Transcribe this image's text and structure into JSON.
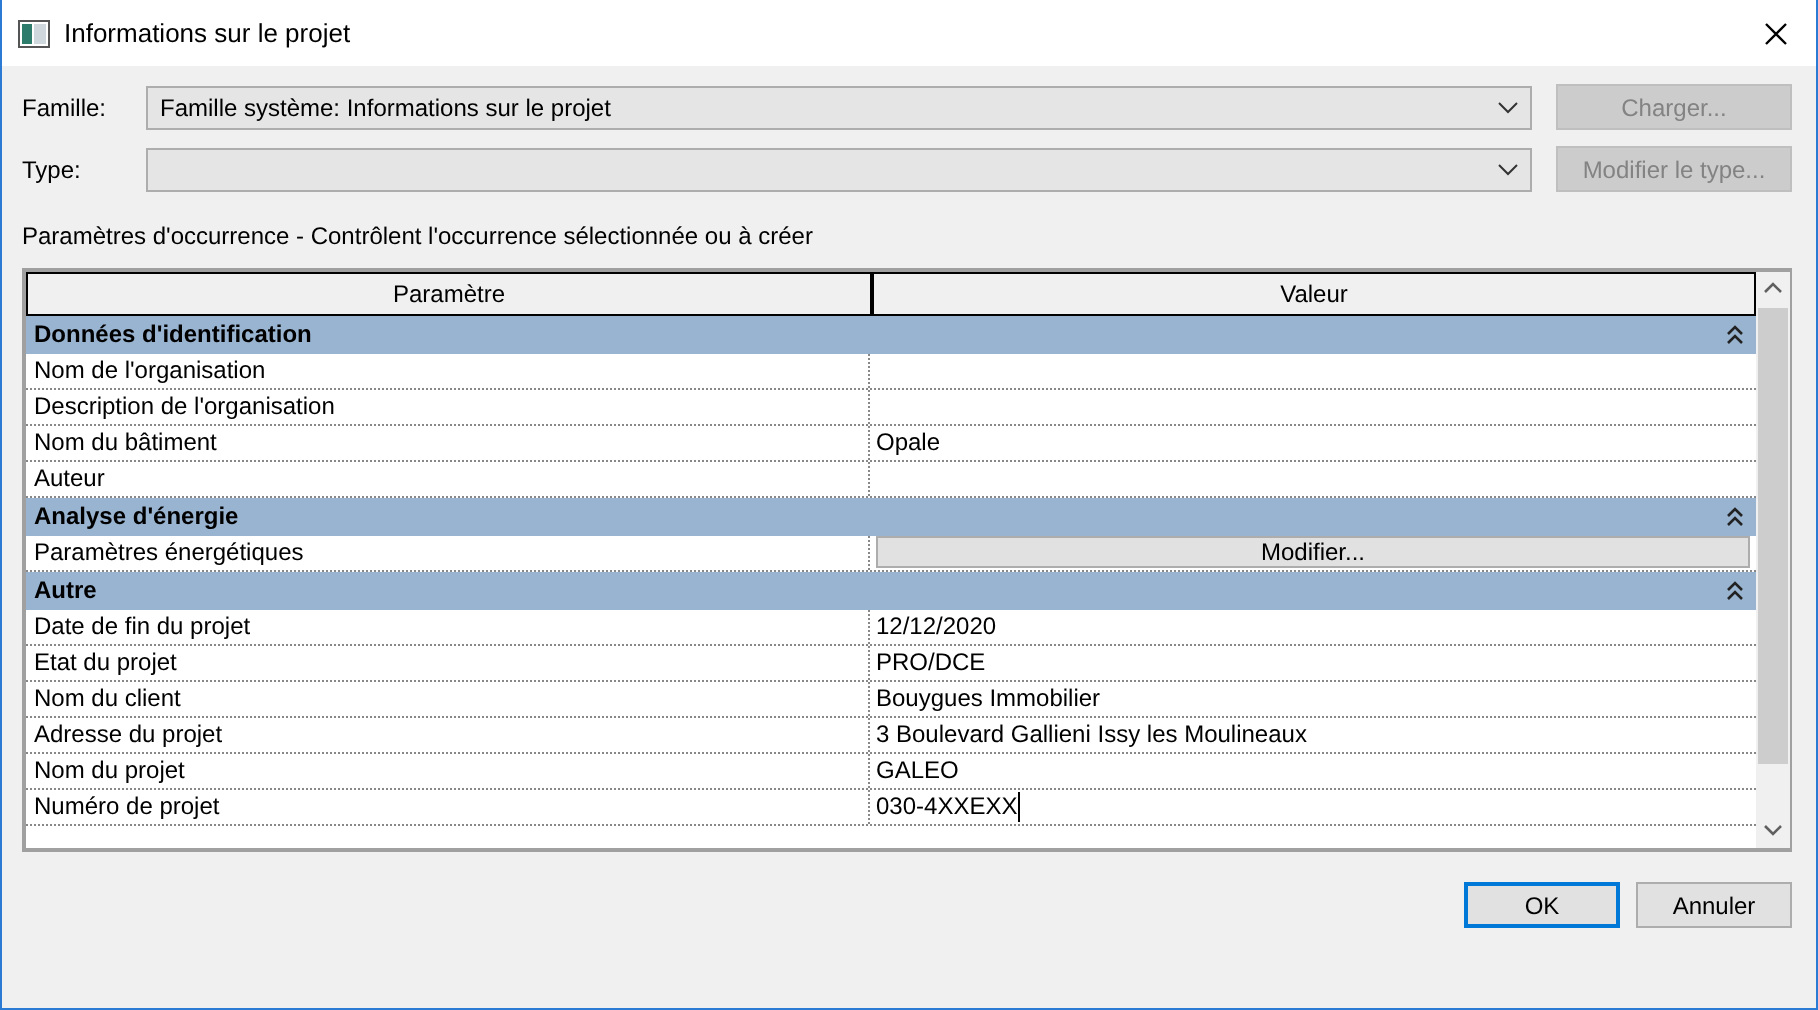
{
  "window": {
    "title": "Informations sur le projet"
  },
  "family": {
    "label": "Famille:",
    "value": "Famille système: Informations sur le projet",
    "button": {
      "label": "Charger...",
      "disabled": true
    }
  },
  "type": {
    "label": "Type:",
    "button": {
      "label": "Modifier le type...",
      "disabled": true
    }
  },
  "section_caption": "Paramètres d'occurrence - Contrôlent l'occurrence sélectionnée ou à créer",
  "table": {
    "columns": [
      "Paramètre",
      "Valeur"
    ],
    "groups": [
      {
        "title": "Données d'identification",
        "expanded": true,
        "rows": [
          {
            "parameter": "Nom de l'organisation",
            "kind": "text",
            "editing": false
          },
          {
            "parameter": "Description de l'organisation",
            "kind": "text",
            "editing": false
          },
          {
            "parameter": "Nom du bâtiment",
            "value": "Opale",
            "kind": "text",
            "editing": false
          },
          {
            "parameter": "Auteur",
            "kind": "text",
            "editing": false
          }
        ]
      },
      {
        "title": "Analyse d'énergie",
        "expanded": true,
        "rows": [
          {
            "parameter": "Paramètres énergétiques",
            "value": "Modifier...",
            "kind": "button",
            "editing": false
          }
        ]
      },
      {
        "title": "Autre",
        "expanded": true,
        "rows": [
          {
            "parameter": "Date de fin du projet",
            "value": "12/12/2020",
            "kind": "text",
            "editing": false
          },
          {
            "parameter": "Etat du projet",
            "value": "PRO/DCE",
            "kind": "text",
            "editing": false
          },
          {
            "parameter": "Nom du client",
            "value": "Bouygues Immobilier",
            "kind": "text",
            "editing": false
          },
          {
            "parameter": "Adresse du projet",
            "value": "3 Boulevard Gallieni Issy les Moulineaux",
            "kind": "text",
            "editing": false
          },
          {
            "parameter": "Nom du projet",
            "value": "GALEO",
            "kind": "text",
            "editing": false
          },
          {
            "parameter": "Numéro de projet",
            "value": "030-4XXEXX",
            "kind": "text",
            "editing": true
          }
        ]
      }
    ]
  },
  "buttons": [
    {
      "label": "OK",
      "default": true
    },
    {
      "label": "Annuler",
      "default": false
    }
  ]
}
